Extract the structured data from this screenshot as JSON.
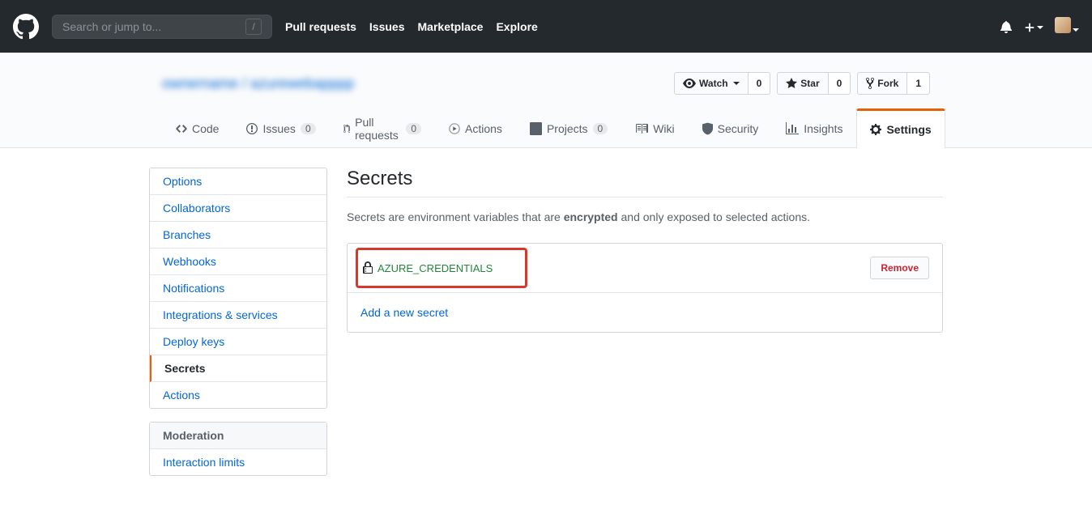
{
  "header": {
    "search_placeholder": "Search or jump to...",
    "slash": "/",
    "nav": [
      "Pull requests",
      "Issues",
      "Marketplace",
      "Explore"
    ]
  },
  "repohead": {
    "title_blurred": "ownername / azurewebapppp",
    "watch": {
      "label": "Watch",
      "count": "0"
    },
    "star": {
      "label": "Star",
      "count": "0"
    },
    "fork": {
      "label": "Fork",
      "count": "1"
    }
  },
  "tabs": {
    "code": "Code",
    "issues": {
      "label": "Issues",
      "count": "0"
    },
    "pulls": {
      "label": "Pull requests",
      "count": "0"
    },
    "actions": "Actions",
    "projects": {
      "label": "Projects",
      "count": "0"
    },
    "wiki": "Wiki",
    "security": "Security",
    "insights": "Insights",
    "settings": "Settings"
  },
  "sidebar": {
    "items": [
      "Options",
      "Collaborators",
      "Branches",
      "Webhooks",
      "Notifications",
      "Integrations & services",
      "Deploy keys",
      "Secrets",
      "Actions"
    ],
    "moderation_heading": "Moderation",
    "moderation_items": [
      "Interaction limits"
    ]
  },
  "page": {
    "title": "Secrets",
    "desc_before": "Secrets are environment variables that are ",
    "desc_bold": "encrypted",
    "desc_after": " and only exposed to selected actions.",
    "secret_name": "AZURE_CREDENTIALS",
    "remove": "Remove",
    "add_new": "Add a new secret"
  }
}
